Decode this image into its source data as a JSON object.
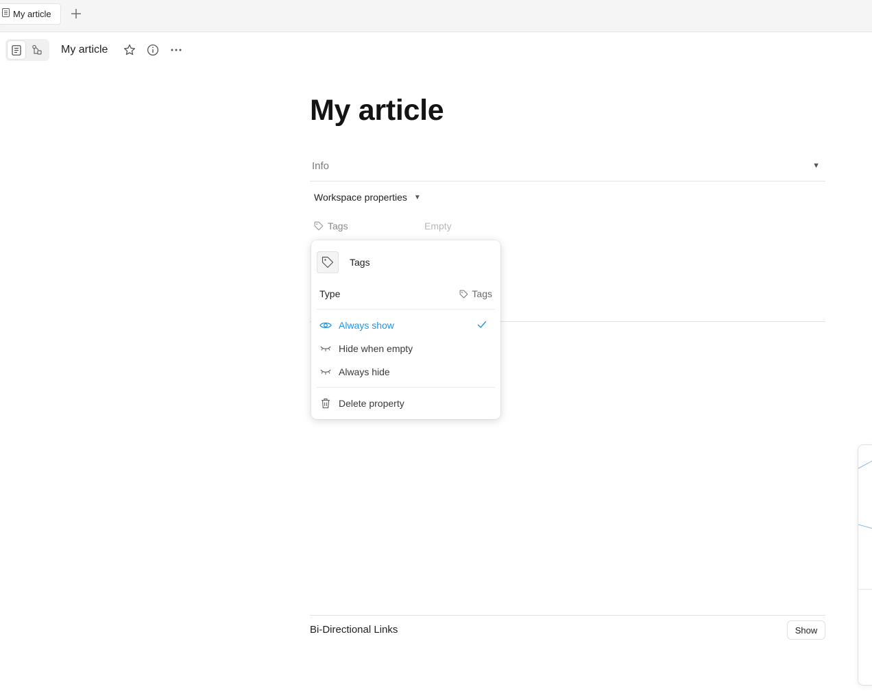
{
  "tabbar": {
    "tab_label": "My article"
  },
  "header": {
    "page_name": "My article"
  },
  "doc": {
    "title": "My article",
    "info_label": "Info",
    "workspace_properties_label": "Workspace properties",
    "tags_property_label": "Tags",
    "tags_property_value": "Empty"
  },
  "popover": {
    "name_value": "Tags",
    "type_label": "Type",
    "type_value": "Tags",
    "options": {
      "always_show": "Always show",
      "hide_when_empty": "Hide when empty",
      "always_hide": "Always hide"
    },
    "selected": "always_show",
    "delete_label": "Delete property"
  },
  "backlinks": {
    "title": "Bi-Directional Links",
    "show_label": "Show"
  },
  "colors": {
    "accent": "#1e96eb",
    "text": "#1f1f1f",
    "muted": "#8a8a8a",
    "border": "#e3e3e3"
  }
}
